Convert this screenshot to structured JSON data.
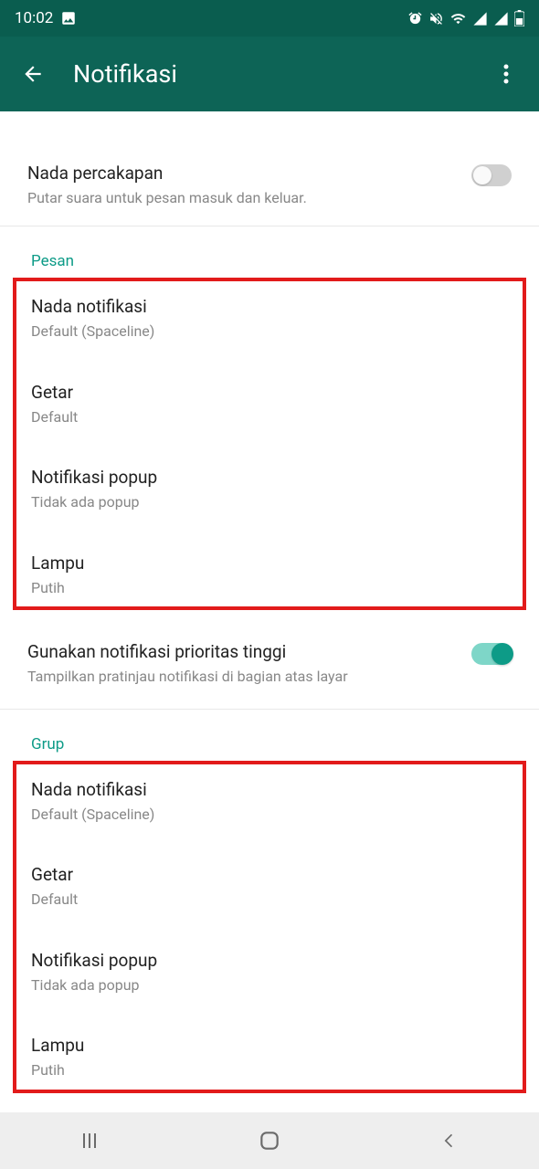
{
  "statusBar": {
    "time": "10:02"
  },
  "header": {
    "title": "Notifikasi"
  },
  "conversationTone": {
    "title": "Nada percakapan",
    "subtitle": "Putar suara untuk pesan masuk dan keluar."
  },
  "sections": {
    "pesan": {
      "label": "Pesan",
      "items": {
        "nada": {
          "title": "Nada notifikasi",
          "subtitle": "Default (Spaceline)"
        },
        "getar": {
          "title": "Getar",
          "subtitle": "Default"
        },
        "popup": {
          "title": "Notifikasi popup",
          "subtitle": "Tidak ada popup"
        },
        "lampu": {
          "title": "Lampu",
          "subtitle": "Putih"
        }
      },
      "priority": {
        "title": "Gunakan notifikasi prioritas tinggi",
        "subtitle": "Tampilkan pratinjau notifikasi di bagian atas layar"
      }
    },
    "grup": {
      "label": "Grup",
      "items": {
        "nada": {
          "title": "Nada notifikasi",
          "subtitle": "Default (Spaceline)"
        },
        "getar": {
          "title": "Getar",
          "subtitle": "Default"
        },
        "popup": {
          "title": "Notifikasi popup",
          "subtitle": "Tidak ada popup"
        },
        "lampu": {
          "title": "Lampu",
          "subtitle": "Putih"
        }
      }
    }
  }
}
